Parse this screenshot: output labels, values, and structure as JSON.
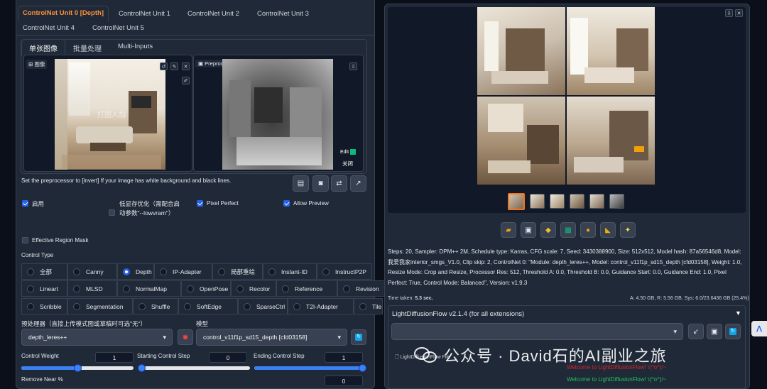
{
  "controlnet_tabs": [
    {
      "label": "ControlNet Unit 0 [Depth]",
      "active": true
    },
    {
      "label": "ControlNet Unit 1"
    },
    {
      "label": "ControlNet Unit 2"
    },
    {
      "label": "ControlNet Unit 3"
    },
    {
      "label": "ControlNet Unit 4"
    },
    {
      "label": "ControlNet Unit 5"
    }
  ],
  "mode_tabs": [
    {
      "label": "单张图像",
      "active": true
    },
    {
      "label": "批量处理"
    },
    {
      "label": "Multi-Inputs"
    }
  ],
  "image_panel": {
    "label": "图像",
    "watermark": "打图人加"
  },
  "preprocessor_preview": {
    "label": "Preprocessor Preview",
    "edit_label": "Edit",
    "close_label": "关闭"
  },
  "hint": "Set the preprocessor to [invert] If your image has white background and black lines.",
  "options": {
    "enable": "启用",
    "low_vram": "低显存优化（需配合启动参数\"--lowvram\"）",
    "pixel_perfect": "Pixel Perfect",
    "allow_preview": "Allow Preview",
    "effective_region_mask": "Effective Region Mask"
  },
  "control_type": {
    "title": "Control Type",
    "rows": [
      [
        "全部",
        "Canny",
        "Depth",
        "IP-Adapter",
        "局部重绘",
        "Instant-ID",
        "InstructP2P"
      ],
      [
        "Lineart",
        "MLSD",
        "NormalMap",
        "OpenPose",
        "Recolor",
        "Reference",
        "Revision"
      ],
      [
        "Scribble",
        "Segmentation",
        "Shuffle",
        "SoftEdge",
        "SparseCtrl",
        "T2I-Adapter",
        "Tile"
      ]
    ],
    "selected": "Depth"
  },
  "preprocessor": {
    "label": "预处理器（直接上传模式图或草稿时可选\"无\"）",
    "value": "depth_leres++"
  },
  "model": {
    "label": "模型",
    "value": "control_v11f1p_sd15_depth [cfd03158]"
  },
  "control_weight": {
    "label": "Control Weight",
    "value": "1",
    "fraction": 0.5
  },
  "starting_step": {
    "label": "Starting Control Step",
    "value": "0",
    "fraction": 0
  },
  "ending_step": {
    "label": "Ending Control Step",
    "value": "1",
    "fraction": 1
  },
  "remove_near": {
    "label": "Remove Near %",
    "value": "0"
  },
  "generation_info": "Steps: 20, Sampler: DPM++ 2M, Schedule type: Karras, CFG scale: 7, Seed: 3430388900, Size: 512x512, Model hash: 87a56546d8, Model: 我爱我家interior_smgs_V1.0, Clip skip: 2, ControlNet 0: \"Module: depth_leres++, Model: control_v11f1p_sd15_depth [cfd03158], Weight: 1.0, Resize Mode: Crop and Resize, Processor Res: 512, Threshold A: 0.0, Threshold B: 0.0, Guidance Start: 0.0, Guidance End: 1.0, Pixel Perfect: True, Control Mode: Balanced\", Version: v1.9.3",
  "time_taken": {
    "label": "Time taken:",
    "value": "5.3 sec."
  },
  "vram": {
    "a": "A: 4.50 GB",
    "r": "R: 5.56 GB",
    "sys": "Sys: 6.0/23.6436 GB (25.4%)"
  },
  "lightflow": {
    "title": "LightDiffusionFlow v2.1.4 (for all extensions)",
    "file_label": "LightDiffusionFlow File",
    "welcome1": "Welcome to LightDiffusionFlow! \\(^o^)/~",
    "welcome2": "Welcome to LightDiffusionFlow! \\(^o^)/~"
  },
  "overlay_watermark": "公众号 · David石的AI副业之旅",
  "colors": {
    "accent": "#fb923c",
    "primary": "#2563eb",
    "bg": "#0b0f19",
    "panel": "#1f2937"
  }
}
